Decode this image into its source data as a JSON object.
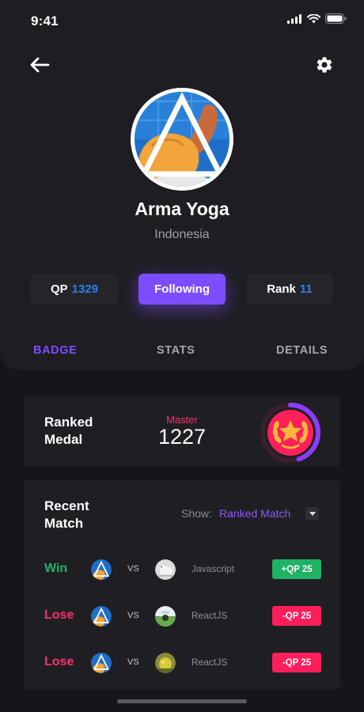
{
  "status_bar": {
    "time": "9:41"
  },
  "nav": {
    "back_icon": "arrow-left-icon",
    "settings_icon": "gear-icon"
  },
  "profile": {
    "name": "Arma Yoga",
    "country": "Indonesia"
  },
  "stats": {
    "qp_label": "QP",
    "qp_value": "1329",
    "follow_label": "Following",
    "rank_label": "Rank",
    "rank_value": "11"
  },
  "tabs": [
    {
      "label": "BADGE",
      "active": true
    },
    {
      "label": "STATS",
      "active": false
    },
    {
      "label": "DETAILS",
      "active": false
    }
  ],
  "ranked_medal": {
    "title": "Ranked Medal",
    "tier": "Master",
    "score": "1227",
    "progress": 0.45
  },
  "recent_match": {
    "title": "Recent Match",
    "show_label": "Show:",
    "show_value": "Ranked Match",
    "matches": [
      {
        "result": "Win",
        "vs": "VS",
        "opponent": "Javascript",
        "qp": "+QP 25"
      },
      {
        "result": "Lose",
        "vs": "VS",
        "opponent": "ReactJS",
        "qp": "-QP 25"
      },
      {
        "result": "Lose",
        "vs": "VS",
        "opponent": "ReactJS",
        "qp": "-QP 25"
      }
    ]
  },
  "colors": {
    "accent": "#7c4dff",
    "qp_blue": "#2f7bf2",
    "win": "#23b26d",
    "lose": "#ff2d6f"
  }
}
